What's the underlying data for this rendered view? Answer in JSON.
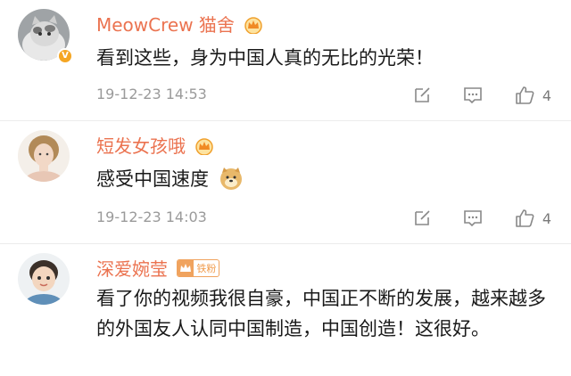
{
  "comments": [
    {
      "username": "MeowCrew 猫舍",
      "text": "看到这些，身为中国人真的无比的光荣！",
      "time": "19-12-23 14:53",
      "likes": "4",
      "avatar": "cat-avatar"
    },
    {
      "username": "短发女孩哦",
      "text": "感受中国速度",
      "time": "19-12-23 14:03",
      "likes": "4",
      "avatar": "girl-avatar"
    },
    {
      "username": "深爱婉莹",
      "badge": "铁粉",
      "text": "看了你的视频我很自豪，中国正不断的发展，越来越多的外国友人认同中国制造，中国创造！这很好。",
      "avatar": "child-avatar"
    }
  ],
  "colors": {
    "username": "#eb7350",
    "meta": "#9a9a9a",
    "verified": "#f5a623"
  }
}
